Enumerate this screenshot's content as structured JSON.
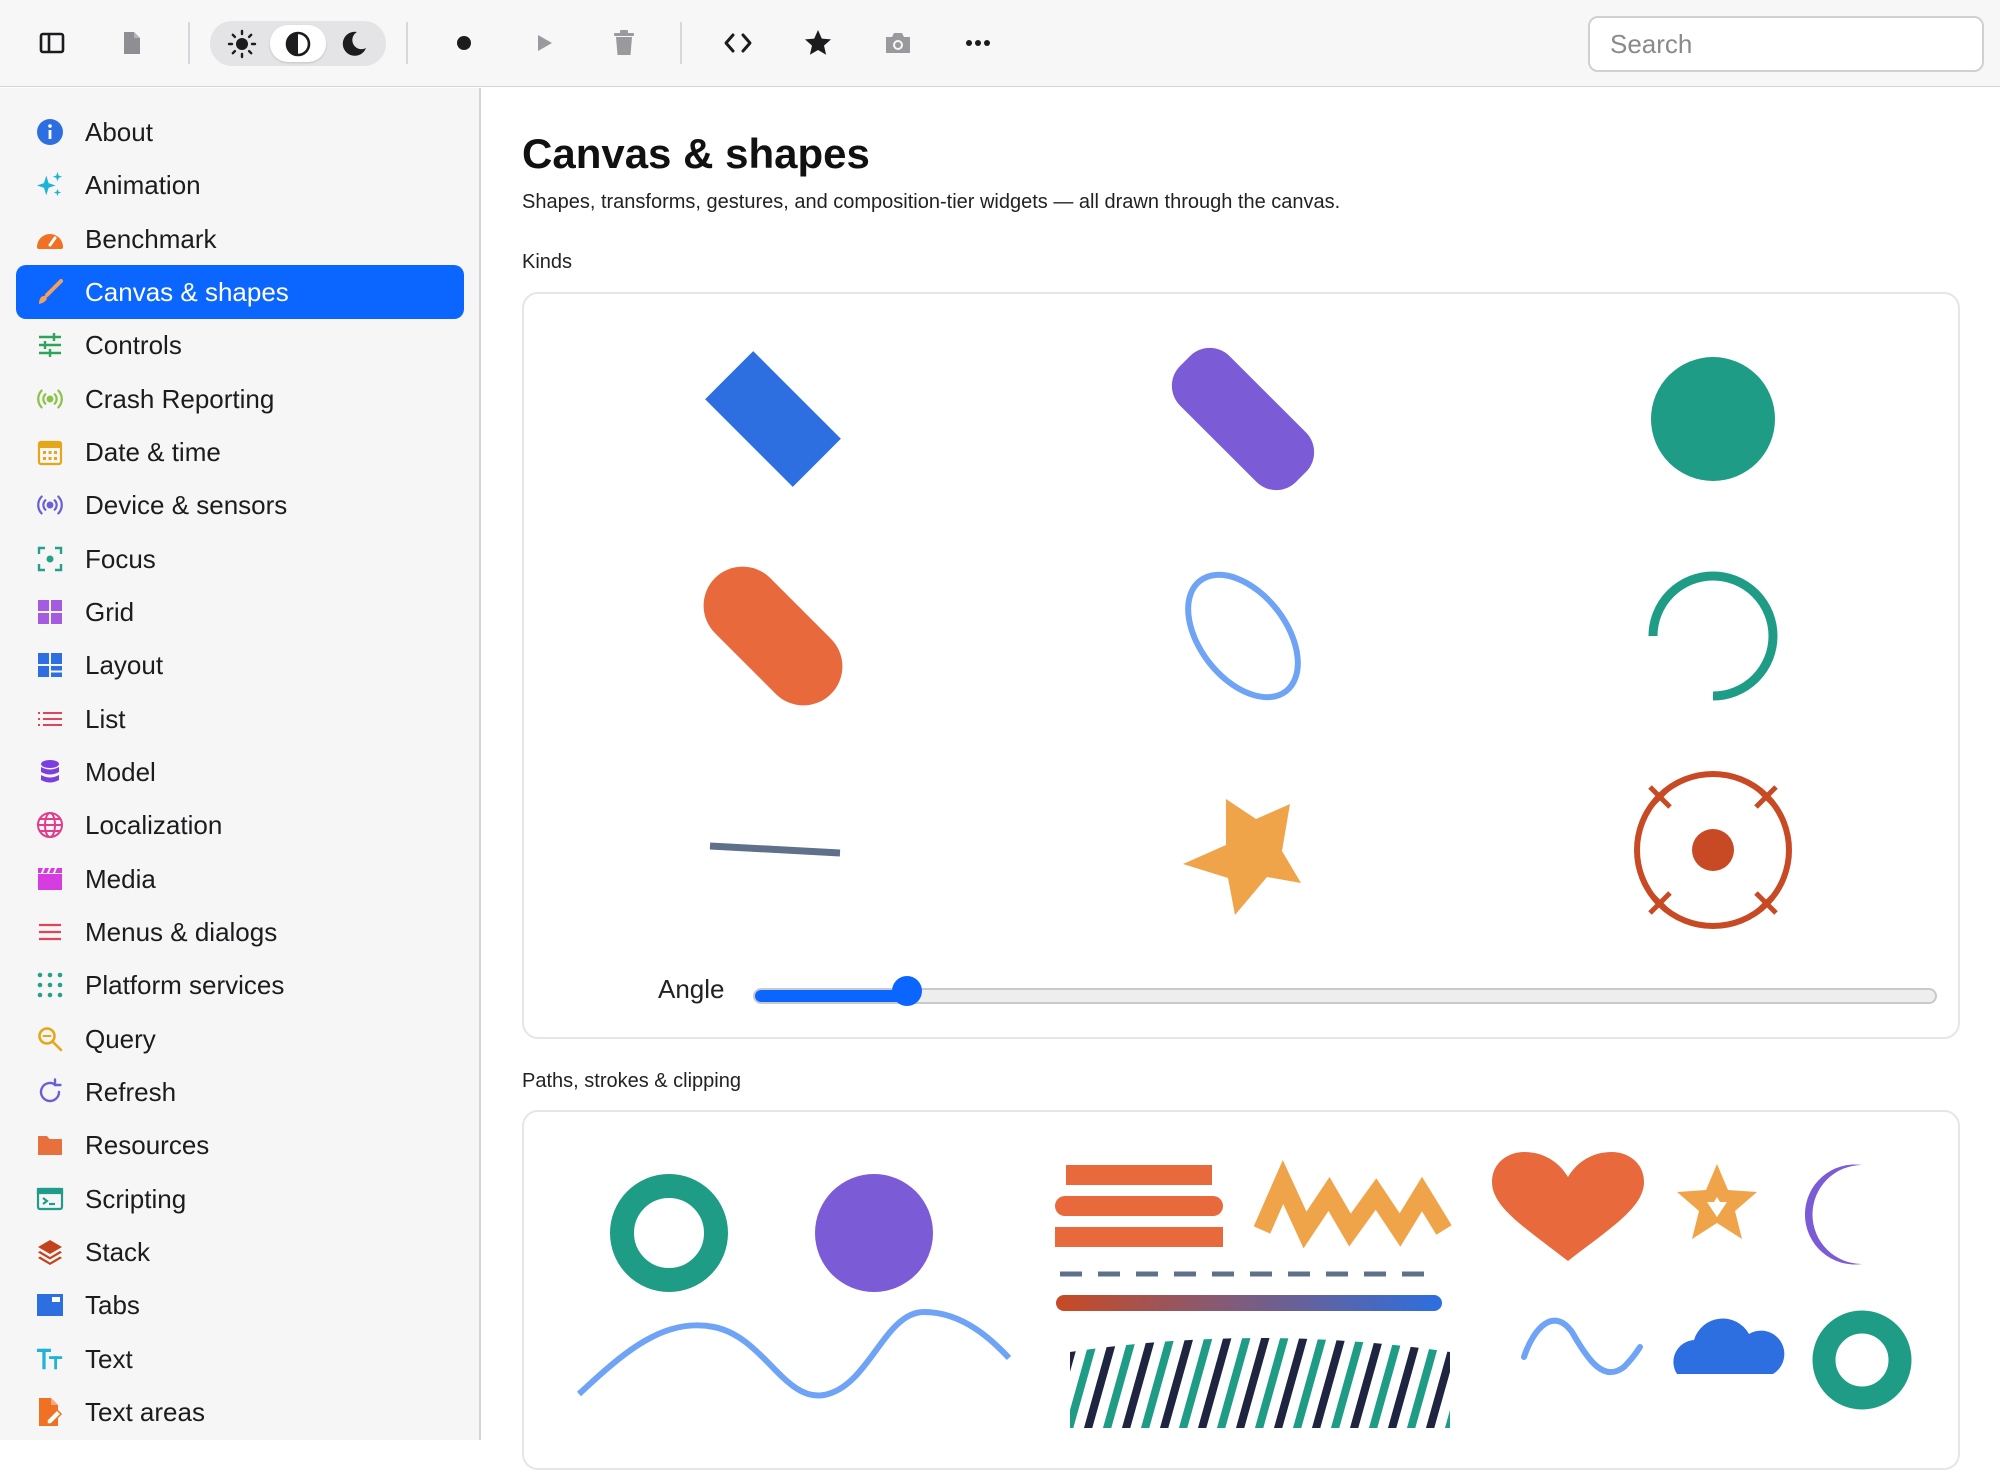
{
  "toolbar": {
    "icons": [
      "sidebar-toggle-icon",
      "document-icon",
      "sun-icon",
      "contrast-icon",
      "moon-icon",
      "record-icon",
      "play-icon",
      "trash-icon",
      "code-icon",
      "star-icon",
      "camera-icon",
      "more-icon"
    ],
    "theme_selected": "system",
    "search_placeholder": "Search"
  },
  "sidebar": {
    "selected": "Canvas & shapes",
    "items": [
      {
        "label": "About",
        "icon": "info-icon",
        "color": "#2d6fe0"
      },
      {
        "label": "Animation",
        "icon": "sparkles-icon",
        "color": "#1fb3d6"
      },
      {
        "label": "Benchmark",
        "icon": "gauge-icon",
        "color": "#f07024"
      },
      {
        "label": "Canvas & shapes",
        "icon": "paintbrush-icon",
        "color": "#f5a05a"
      },
      {
        "label": "Controls",
        "icon": "sliders-icon",
        "color": "#2fa35a"
      },
      {
        "label": "Crash Reporting",
        "icon": "broadcast-icon",
        "color": "#8bc34a"
      },
      {
        "label": "Date & time",
        "icon": "calendar-icon",
        "color": "#e3a71a"
      },
      {
        "label": "Device & sensors",
        "icon": "sensor-icon",
        "color": "#6b5fd6"
      },
      {
        "label": "Focus",
        "icon": "focus-icon",
        "color": "#25a08a"
      },
      {
        "label": "Grid",
        "icon": "grid-icon",
        "color": "#a45be0"
      },
      {
        "label": "Layout",
        "icon": "layout-icon",
        "color": "#2d6fe0"
      },
      {
        "label": "List",
        "icon": "list-icon",
        "color": "#e0435a"
      },
      {
        "label": "Model",
        "icon": "database-icon",
        "color": "#7b3fe0"
      },
      {
        "label": "Localization",
        "icon": "globe-icon",
        "color": "#e23d8a"
      },
      {
        "label": "Media",
        "icon": "clapperboard-icon",
        "color": "#d63de0"
      },
      {
        "label": "Menus & dialogs",
        "icon": "menu-icon",
        "color": "#e0435a"
      },
      {
        "label": "Platform services",
        "icon": "dots-grid-icon",
        "color": "#25a08a"
      },
      {
        "label": "Query",
        "icon": "magnifier-icon",
        "color": "#e3a71a"
      },
      {
        "label": "Refresh",
        "icon": "refresh-icon",
        "color": "#6b5fd6"
      },
      {
        "label": "Resources",
        "icon": "folder-icon",
        "color": "#e8703c"
      },
      {
        "label": "Scripting",
        "icon": "terminal-icon",
        "color": "#1f9c8a"
      },
      {
        "label": "Stack",
        "icon": "stack-icon",
        "color": "#c2441f"
      },
      {
        "label": "Tabs",
        "icon": "tabs-icon",
        "color": "#2d6fe0"
      },
      {
        "label": "Text",
        "icon": "text-icon",
        "color": "#1fb3d6"
      },
      {
        "label": "Text areas",
        "icon": "doc-edit-icon",
        "color": "#f07024"
      }
    ]
  },
  "main": {
    "title": "Canvas & shapes",
    "subtitle": "Shapes, transforms, gestures, and composition-tier widgets — all drawn through the canvas.",
    "kinds_label": "Kinds",
    "angle_label": "Angle",
    "angle_value": 0.13,
    "paths_label": "Paths, strokes & clipping",
    "shape_colors": {
      "blue": "#2d6fe0",
      "purple": "#7b5bd6",
      "teal": "#1f9c85",
      "orange": "#e8693c",
      "lightblue": "#6ea3f5",
      "slate": "#5f708a",
      "amber": "#f0a44a",
      "rust": "#c84a24",
      "navy": "#1f2540"
    }
  }
}
